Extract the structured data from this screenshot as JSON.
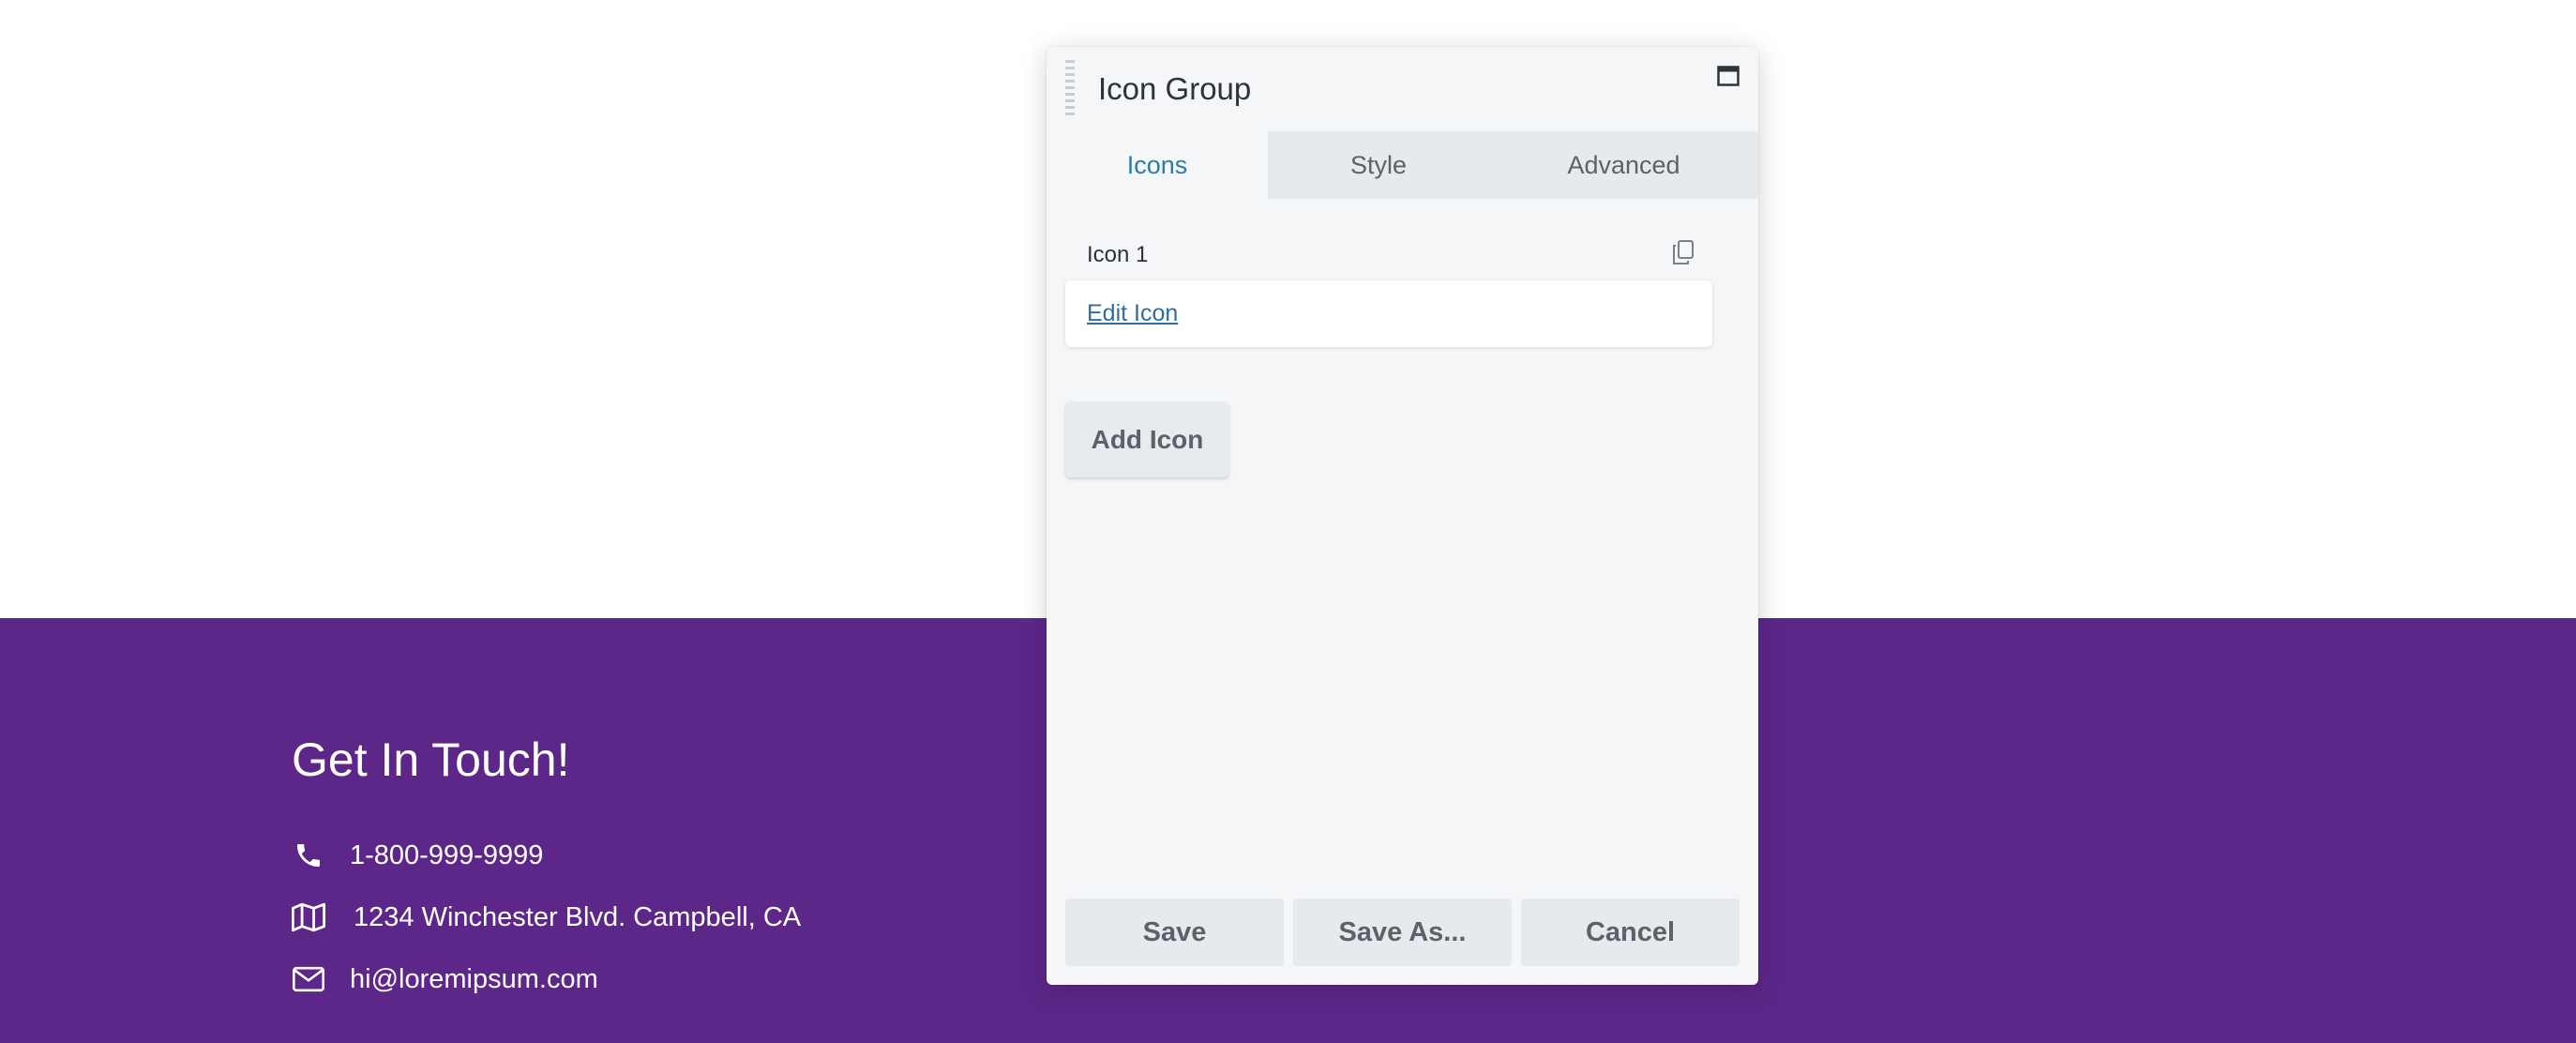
{
  "footer": {
    "title": "Get In Touch!",
    "contacts": [
      {
        "icon": "phone-icon",
        "text": "1-800-999-9999"
      },
      {
        "icon": "map-icon",
        "text": "1234 Winchester Blvd. Campbell, CA"
      },
      {
        "icon": "envelope-icon",
        "text": "hi@loremipsum.com"
      }
    ],
    "background_color": "#5d2789"
  },
  "panel": {
    "title": "Icon Group",
    "tabs": [
      {
        "label": "Icons",
        "active": true
      },
      {
        "label": "Style",
        "active": false
      },
      {
        "label": "Advanced",
        "active": false
      }
    ],
    "items": [
      {
        "label": "Icon 1",
        "edit_label": "Edit Icon"
      }
    ],
    "add_label": "Add Icon",
    "buttons": {
      "save": "Save",
      "save_as": "Save As...",
      "cancel": "Cancel"
    },
    "accent_color": "#2d7baa"
  }
}
